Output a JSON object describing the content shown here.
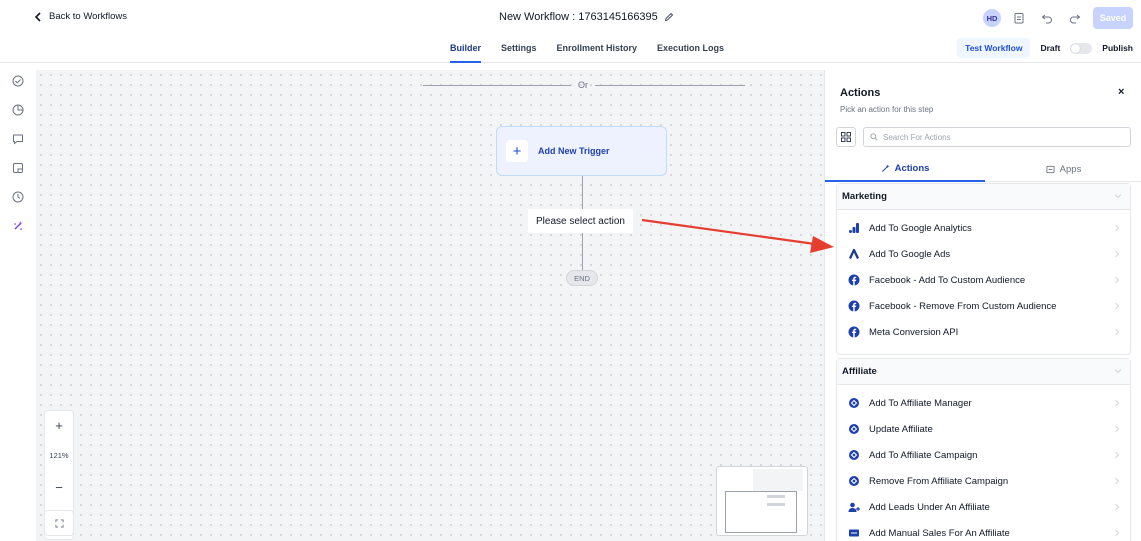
{
  "header": {
    "back_label": "Back to Workflows",
    "workflow_title": "New Workflow : 1763145166395",
    "avatar_initials": "HD",
    "saved_label": "Saved"
  },
  "tabs": [
    {
      "label": "Builder",
      "active": true
    },
    {
      "label": "Settings"
    },
    {
      "label": "Enrollment History"
    },
    {
      "label": "Execution Logs"
    }
  ],
  "tab_actions": {
    "test_label": "Test Workflow",
    "draft_label": "Draft",
    "publish_label": "Publish"
  },
  "canvas": {
    "or_label": "Or",
    "trigger_label": "Add New Trigger",
    "select_action_label": "Please select action",
    "end_label": "END",
    "zoom_level": "121%",
    "zoom_in": "+",
    "zoom_out": "−"
  },
  "panel": {
    "title": "Actions",
    "subtitle": "Pick an action for this step",
    "close": "×",
    "search_placeholder": "Search For Actions",
    "tabs": [
      {
        "label": "Actions",
        "icon": "magic-icon",
        "active": true
      },
      {
        "label": "Apps",
        "icon": "apps-icon"
      }
    ],
    "sections": [
      {
        "title": "Marketing",
        "items": [
          {
            "label": "Add To Google Analytics",
            "icon": "google-analytics-icon"
          },
          {
            "label": "Add To Google Ads",
            "icon": "google-ads-icon"
          },
          {
            "label": "Facebook - Add To Custom Audience",
            "icon": "facebook-icon"
          },
          {
            "label": "Facebook - Remove From Custom Audience",
            "icon": "facebook-icon"
          },
          {
            "label": "Meta Conversion API",
            "icon": "facebook-icon"
          }
        ]
      },
      {
        "title": "Affiliate",
        "items": [
          {
            "label": "Add To Affiliate Manager",
            "icon": "affiliate-icon"
          },
          {
            "label": "Update Affiliate",
            "icon": "affiliate-icon"
          },
          {
            "label": "Add To Affiliate Campaign",
            "icon": "affiliate-icon"
          },
          {
            "label": "Remove From Affiliate Campaign",
            "icon": "affiliate-icon"
          },
          {
            "label": "Add Leads Under An Affiliate",
            "icon": "add-user-icon"
          },
          {
            "label": "Add Manual Sales For An Affiliate",
            "icon": "sales-icon"
          }
        ]
      }
    ]
  },
  "colors": {
    "accent": "#2563eb",
    "arrow": "#e53e2f",
    "trigger_bg": "#eef2ff",
    "facebook": "#1877f2"
  }
}
